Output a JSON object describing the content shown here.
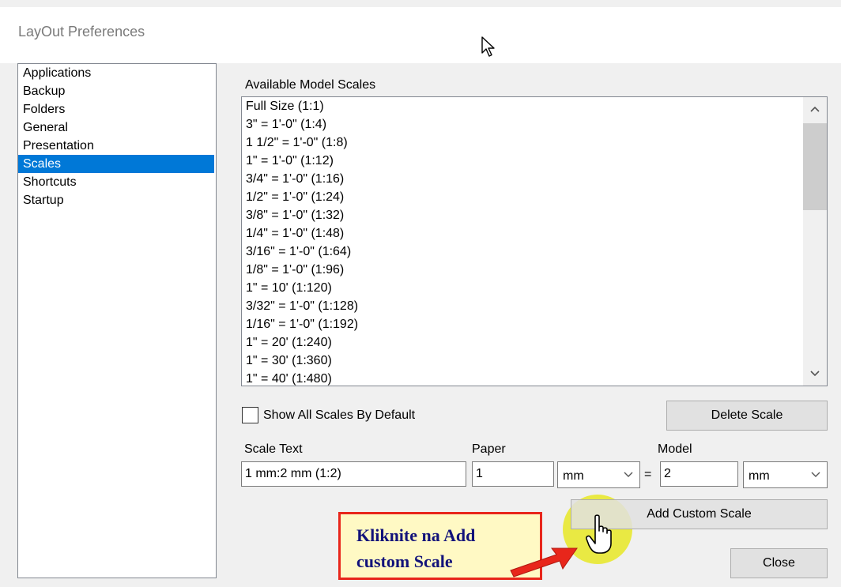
{
  "window": {
    "title": "LayOut Preferences"
  },
  "nav": {
    "items": [
      {
        "label": "Applications",
        "selected": false
      },
      {
        "label": "Backup",
        "selected": false
      },
      {
        "label": "Folders",
        "selected": false
      },
      {
        "label": "General",
        "selected": false
      },
      {
        "label": "Presentation",
        "selected": false
      },
      {
        "label": "Scales",
        "selected": true
      },
      {
        "label": "Shortcuts",
        "selected": false
      },
      {
        "label": "Startup",
        "selected": false
      }
    ]
  },
  "scales": {
    "header": "Available Model Scales",
    "items": [
      "Full Size (1:1)",
      "3\" = 1'-0\" (1:4)",
      "1 1/2\" = 1'-0\" (1:8)",
      "1\" = 1'-0\" (1:12)",
      "3/4\" = 1'-0\" (1:16)",
      "1/2\" = 1'-0\" (1:24)",
      "3/8\" = 1'-0\" (1:32)",
      "1/4\" = 1'-0\" (1:48)",
      "3/16\" = 1'-0\" (1:64)",
      "1/8\" = 1'-0\" (1:96)",
      "1\" = 10' (1:120)",
      "3/32\" = 1'-0\" (1:128)",
      "1/16\" = 1'-0\" (1:192)",
      "1\" = 20' (1:240)",
      "1\" = 30' (1:360)",
      "1\" = 40' (1:480)"
    ],
    "show_all_label": "Show All Scales By Default",
    "show_all_checked": false,
    "delete_label": "Delete Scale"
  },
  "custom": {
    "scale_text_label": "Scale Text",
    "scale_text_value": "1 mm:2 mm (1:2)",
    "paper_label": "Paper",
    "paper_value": "1",
    "paper_unit": "mm",
    "equals": "=",
    "model_label": "Model",
    "model_value": "2",
    "model_unit": "mm",
    "add_label": "Add Custom Scale"
  },
  "close_label": "Close",
  "annotation": {
    "line1": "Kliknite na Add",
    "line2": "custom Scale",
    "border_color": "#e8261b",
    "text_color": "#12127a"
  },
  "icons": {
    "scroll_up": "chevron-up-icon",
    "scroll_down": "chevron-down-icon",
    "pointer": "mouse-arrow-icon",
    "hand": "hand-cursor-icon"
  }
}
